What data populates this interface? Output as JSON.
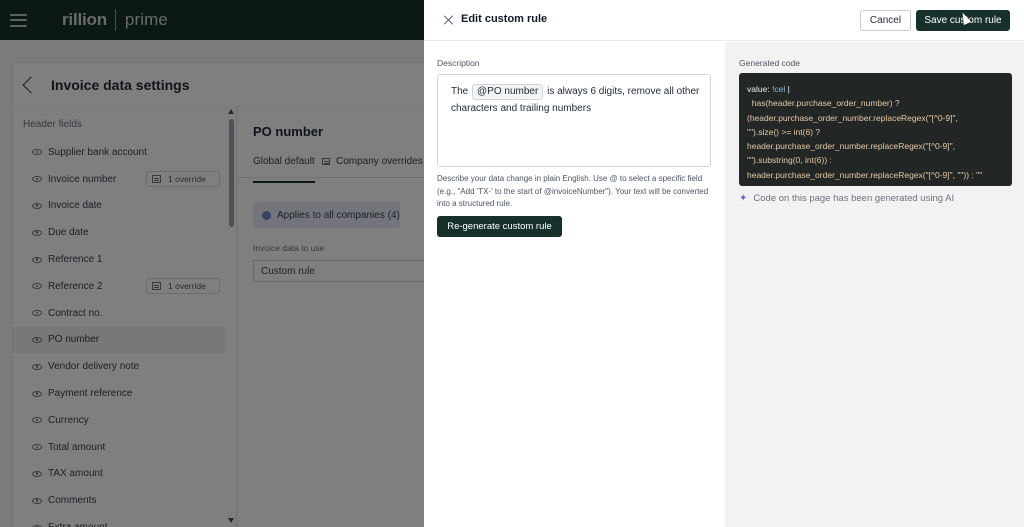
{
  "app": {
    "brand": "rillion",
    "product": "prime"
  },
  "page": {
    "title": "Invoice data settings",
    "section_label": "Header fields"
  },
  "fields": [
    {
      "label": "Supplier bank account",
      "badge": ""
    },
    {
      "label": "Invoice number",
      "badge": "1 override"
    },
    {
      "label": "Invoice date",
      "badge": ""
    },
    {
      "label": "Due date",
      "badge": ""
    },
    {
      "label": "Reference 1",
      "badge": ""
    },
    {
      "label": "Reference 2",
      "badge": "1 override"
    },
    {
      "label": "Contract no.",
      "badge": ""
    },
    {
      "label": "PO number",
      "badge": ""
    },
    {
      "label": "Vendor delivery note",
      "badge": ""
    },
    {
      "label": "Payment reference",
      "badge": ""
    },
    {
      "label": "Currency",
      "badge": ""
    },
    {
      "label": "Total amount",
      "badge": ""
    },
    {
      "label": "TAX amount",
      "badge": ""
    },
    {
      "label": "Comments",
      "badge": ""
    },
    {
      "label": "Extra amount",
      "badge": ""
    }
  ],
  "main": {
    "title": "PO number",
    "tab_global": "Global default",
    "tab_company": "Company overrides",
    "applies": "Applies to all companies (4)",
    "data_label": "Invoice data to use",
    "data_value": "Custom rule"
  },
  "drawer": {
    "title": "Edit custom rule",
    "cancel": "Cancel",
    "save": "Save custom rule",
    "description_label": "Description",
    "desc_pre": "The",
    "desc_chip": "@PO number",
    "desc_post": "is always 6 digits, remove all other characters and trailing numbers",
    "help": "Describe your data change in plain English. Use @ to select a specific field (e.g., \"Add 'TX-' to the start of @invoiceNumber\"). Your text will be converted into a structured rule.",
    "regenerate": "Re-generate custom rule",
    "generated_label": "Generated code",
    "code_key": "value",
    "code_sep": ": ",
    "code_tag": "!cel",
    "code_pipe": " |",
    "code_body": "\n  has(header.purchase_order_number) ?\n(header.purchase_order_number.replaceRegex(\"[^0-9]\",\n\"\").size() >= int(6) ?\nheader.purchase_order_number.replaceRegex(\"[^0-9]\",\n\"\").substring(0, int(6)) :\nheader.purchase_order_number.replaceRegex(\"[^0-9]\", \"\")) : \"\"",
    "ai_note": "Code on this page has been generated using AI"
  }
}
